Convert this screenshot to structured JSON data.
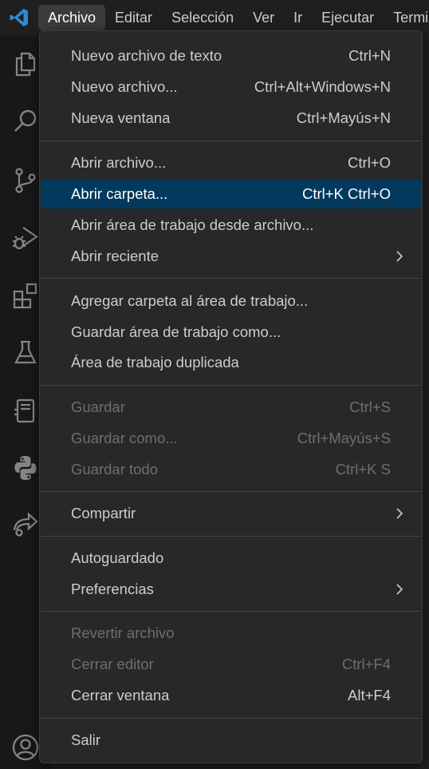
{
  "menubar": {
    "items": [
      {
        "label": "Archivo"
      },
      {
        "label": "Editar"
      },
      {
        "label": "Selección"
      },
      {
        "label": "Ver"
      },
      {
        "label": "Ir"
      },
      {
        "label": "Ejecutar"
      },
      {
        "label": "Terminal"
      }
    ]
  },
  "activity": {
    "icons": [
      "explorer-icon",
      "search-icon",
      "source-control-icon",
      "run-debug-icon",
      "extensions-icon",
      "testing-icon",
      "remote-explorer-icon",
      "python-icon",
      "live-share-icon",
      "accounts-icon"
    ]
  },
  "colors": {
    "accent_selected": "#04395e",
    "vscode_blue": "#2c8bd7",
    "menu_bg": "#282828"
  },
  "file_menu": {
    "new_text_file": {
      "label": "Nuevo archivo de texto",
      "shortcut": "Ctrl+N"
    },
    "new_file": {
      "label": "Nuevo archivo...",
      "shortcut": "Ctrl+Alt+Windows+N"
    },
    "new_window": {
      "label": "Nueva ventana",
      "shortcut": "Ctrl+Mayús+N"
    },
    "open_file": {
      "label": "Abrir archivo...",
      "shortcut": "Ctrl+O"
    },
    "open_folder": {
      "label": "Abrir carpeta...",
      "shortcut": "Ctrl+K Ctrl+O"
    },
    "open_workspace": {
      "label": "Abrir área de trabajo desde archivo..."
    },
    "open_recent": {
      "label": "Abrir reciente"
    },
    "add_folder": {
      "label": "Agregar carpeta al área de trabajo..."
    },
    "save_workspace_as": {
      "label": "Guardar área de trabajo como..."
    },
    "duplicate_workspace": {
      "label": "Área de trabajo duplicada"
    },
    "save": {
      "label": "Guardar",
      "shortcut": "Ctrl+S"
    },
    "save_as": {
      "label": "Guardar como...",
      "shortcut": "Ctrl+Mayús+S"
    },
    "save_all": {
      "label": "Guardar todo",
      "shortcut": "Ctrl+K S"
    },
    "share": {
      "label": "Compartir"
    },
    "auto_save": {
      "label": "Autoguardado"
    },
    "preferences": {
      "label": "Preferencias"
    },
    "revert_file": {
      "label": "Revertir archivo"
    },
    "close_editor": {
      "label": "Cerrar editor",
      "shortcut": "Ctrl+F4"
    },
    "close_window": {
      "label": "Cerrar ventana",
      "shortcut": "Alt+F4"
    },
    "exit": {
      "label": "Salir"
    }
  }
}
